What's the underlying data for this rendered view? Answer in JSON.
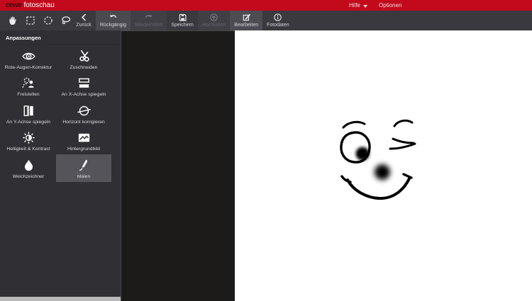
{
  "titlebar": {
    "logo": {
      "brand": "cewe",
      "product": "fotoschau"
    },
    "menus": [
      {
        "id": "hilfe",
        "label": "Hilfe",
        "has_dropdown": true
      },
      {
        "id": "optionen",
        "label": "Optionen",
        "has_dropdown": false
      }
    ],
    "accent_color": "#c20a1c"
  },
  "toolbar": {
    "buttons": [
      {
        "id": "zurueck",
        "label": "Zurück",
        "icon": "back",
        "state": "normal"
      },
      {
        "id": "rueckgaengig",
        "label": "Rückgängig",
        "icon": "undo",
        "state": "highlighted"
      },
      {
        "id": "wiederholen",
        "label": "Wiederholen",
        "icon": "redo",
        "state": "disabled"
      },
      {
        "id": "speichern",
        "label": "Speichern",
        "icon": "save",
        "state": "normal"
      },
      {
        "id": "hochladen",
        "label": "Hochladen",
        "icon": "upload",
        "state": "disabled"
      },
      {
        "id": "bearbeiten",
        "label": "Bearbeiten",
        "icon": "edit",
        "state": "active"
      },
      {
        "id": "fotodaten",
        "label": "Fotodaten",
        "icon": "info",
        "state": "normal"
      }
    ],
    "tools": [
      {
        "id": "hand-tool",
        "icon": "hand"
      },
      {
        "id": "rect-select-tool",
        "icon": "rect-select"
      },
      {
        "id": "ellipse-select-tool",
        "icon": "ellipse-select"
      },
      {
        "id": "lasso-tool",
        "icon": "lasso"
      }
    ]
  },
  "sidebar": {
    "header": "Anpassungen",
    "tools": [
      {
        "id": "rote-augen-korrektur",
        "label": "Rote-Augen-Korrektur",
        "icon": "eye",
        "selected": false
      },
      {
        "id": "zuschneiden",
        "label": "Zuschneiden",
        "icon": "scissors",
        "selected": false
      },
      {
        "id": "freistellen",
        "label": "Freistellen",
        "icon": "cutout",
        "selected": false
      },
      {
        "id": "an-x-achse-spiegeln",
        "label": "An X-Achse spiegeln",
        "icon": "flip-x",
        "selected": false
      },
      {
        "id": "an-y-achse-spiegeln",
        "label": "An Y-Achse spiegeln",
        "icon": "flip-y",
        "selected": false
      },
      {
        "id": "horizont-korrigieren",
        "label": "Horizont korrigieren",
        "icon": "horizon",
        "selected": false
      },
      {
        "id": "helligkeit-kontrast",
        "label": "Helligkeit & Kontrast",
        "icon": "brightness",
        "selected": false
      },
      {
        "id": "hintergrundbild",
        "label": "Hintergrundbild",
        "icon": "background",
        "selected": false
      },
      {
        "id": "weichzeichner",
        "label": "Weichzeichner",
        "icon": "blur-drop",
        "selected": false
      },
      {
        "id": "malen",
        "label": "Malen",
        "icon": "paint",
        "selected": true
      }
    ]
  },
  "canvas": {
    "content": "hand-drawn winking smiley face"
  }
}
